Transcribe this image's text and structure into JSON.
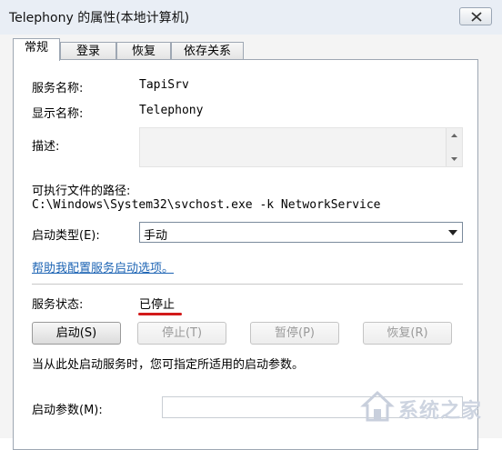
{
  "window": {
    "title": "Telephony 的属性(本地计算机)"
  },
  "tabs": [
    {
      "label": "常规"
    },
    {
      "label": "登录"
    },
    {
      "label": "恢复"
    },
    {
      "label": "依存关系"
    }
  ],
  "general": {
    "service_name_label": "服务名称:",
    "service_name_value": "TapiSrv",
    "display_name_label": "显示名称:",
    "display_name_value": "Telephony",
    "description_label": "描述:",
    "path_label": "可执行文件的路径:",
    "path_value": "C:\\Windows\\System32\\svchost.exe -k NetworkService",
    "startup_type_label": "启动类型(E):",
    "startup_type_value": "手动",
    "help_link": "帮助我配置服务启动选项。",
    "status_label": "服务状态:",
    "status_value": "已停止",
    "buttons": {
      "start": "启动(S)",
      "stop": "停止(T)",
      "pause": "暂停(P)",
      "resume": "恢复(R)"
    },
    "hint": "当从此处启动服务时，您可指定所适用的启动参数。",
    "params_label": "启动参数(M):"
  },
  "watermark": {
    "text": "系统之家"
  },
  "colors": {
    "link": "#1d64b4",
    "status_underline": "#d21a1a"
  }
}
